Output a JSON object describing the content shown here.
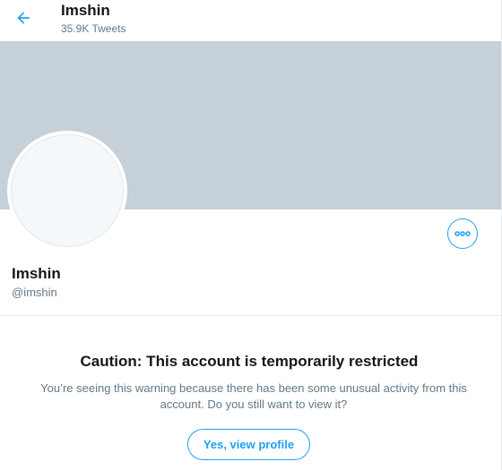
{
  "header": {
    "title": "Imshin",
    "tweet_count": "35.9K Tweets",
    "back_icon": "arrow-left-icon"
  },
  "profile": {
    "display_name": "Imshin",
    "handle": "@imshin",
    "more_icon": "ellipsis-icon"
  },
  "warning": {
    "title": "Caution: This account is temporarily restricted",
    "message": "You’re seeing this warning because there has been some unusual activity from this account. Do you still want to view it?",
    "button_label": "Yes, view profile"
  },
  "colors": {
    "accent": "#1da1f2",
    "banner": "#c5d0d8",
    "secondary_text": "#657786",
    "primary_text": "#14171a"
  }
}
